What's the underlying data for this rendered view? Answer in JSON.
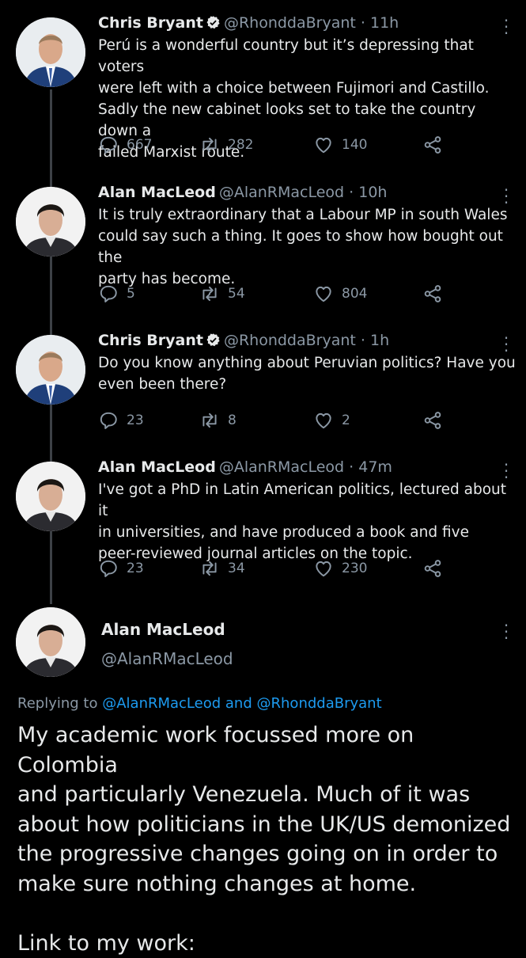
{
  "tweets": [
    {
      "name": "Chris Bryant",
      "handle": "@RhonddaBryant",
      "separator": "·",
      "time": "11h",
      "text": "Perú is a wonderful country but it’s depressing that voters\nwere left with a choice between Fujimori and Castillo.\nSadly the new cabinet looks set to take the country down a\nfailed Marxist route.",
      "replies": "667",
      "retweets": "282",
      "likes": "140"
    },
    {
      "name": "Alan MacLeod",
      "handle": "@AlanRMacLeod",
      "separator": "·",
      "time": "10h",
      "text": "It is truly extraordinary that a Labour MP in south Wales\ncould say such a thing. It goes to show how bought out the\nparty has become.",
      "replies": "5",
      "retweets": "54",
      "likes": "804"
    },
    {
      "name": "Chris Bryant",
      "handle": "@RhonddaBryant",
      "separator": "·",
      "time": "1h",
      "text": "Do you know anything about Peruvian politics? Have you\neven been there?",
      "replies": "23",
      "retweets": "8",
      "likes": "2"
    },
    {
      "name": "Alan MacLeod",
      "handle": "@AlanRMacLeod",
      "separator": "·",
      "time": "47m",
      "text": "I've got a PhD in Latin American politics, lectured about it\nin universities, and have produced a book and five\npeer-reviewed journal articles on the topic.",
      "replies": "23",
      "retweets": "34",
      "likes": "230"
    }
  ],
  "main_tweet": {
    "name": "Alan MacLeod",
    "handle": "@AlanRMacLeod",
    "replying_prefix": "Replying to",
    "replying_to_1": "@AlanRMacLeod",
    "replying_and": "and",
    "replying_to_2": "@RhonddaBryant",
    "text": "My academic work focussed more on Colombia\nand particularly Venezuela. Much of it was\nabout how politicians in the UK/US demonized\nthe progressive changes going on in order to\nmake sure nothing changes at home.\n\nLink to my work:"
  },
  "icons": [
    "verified-badge-icon",
    "more-options-icon",
    "reply-icon",
    "retweet-icon",
    "like-icon",
    "share-icon"
  ],
  "colors": {
    "background": "#000000",
    "text": "#e7e9ea",
    "secondary": "#8b98a5",
    "link": "#1d9bf0",
    "verified": "#e7e9ea"
  }
}
